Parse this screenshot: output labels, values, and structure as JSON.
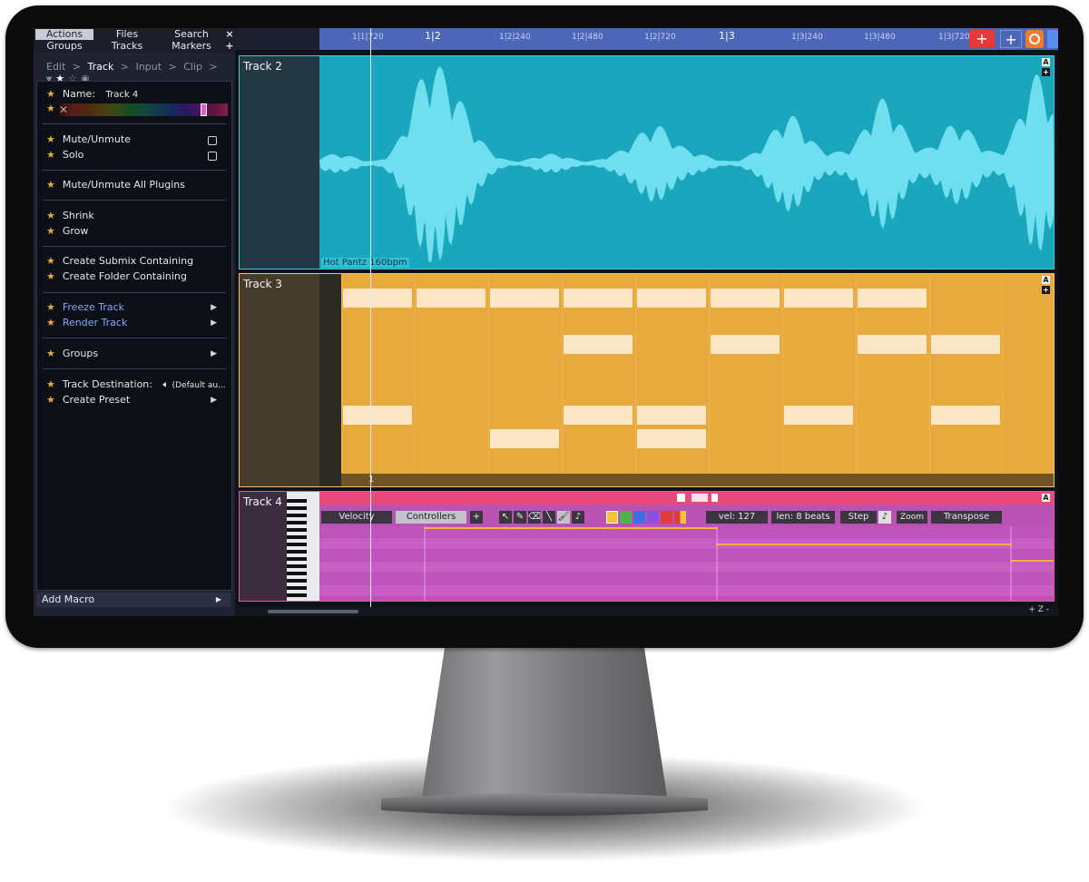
{
  "sidebar": {
    "tabs": [
      {
        "label": "Actions"
      },
      {
        "label": "Files"
      },
      {
        "label": "Search"
      },
      {
        "label": "Groups"
      },
      {
        "label": "Tracks"
      },
      {
        "label": "Markers"
      }
    ],
    "close_glyph": "×",
    "add_glyph": "+",
    "breadcrumb": [
      "Edit",
      ">",
      "Track",
      ">",
      "Input",
      ">",
      "Clip",
      ">"
    ],
    "name_label": "Name:",
    "name_value": "Track 4",
    "items": [
      {
        "label": "Mute/Unmute"
      },
      {
        "label": "Solo"
      },
      {
        "label": "Mute/Unmute All Plugins"
      },
      {
        "label": "Shrink"
      },
      {
        "label": "Grow"
      },
      {
        "label": "Create Submix Containing"
      },
      {
        "label": "Create Folder Containing"
      },
      {
        "label": "Freeze Track"
      },
      {
        "label": "Render Track"
      },
      {
        "label": "Groups"
      },
      {
        "label": "Track Destination:"
      },
      {
        "label": "Create Preset"
      }
    ],
    "destination_value": "(Default au...",
    "add_macro": "Add Macro"
  },
  "ruler": {
    "ticks": [
      "1|1|720",
      "1|2",
      "1|2|240",
      "1|2|480",
      "1|2|720",
      "1|3",
      "1|3|240",
      "1|3|480",
      "1|3|720"
    ]
  },
  "tracks": {
    "track2": {
      "name": "Track 2",
      "clip_label": "Hot Pantz 160bpm",
      "color": "#1aa6bc"
    },
    "track3": {
      "name": "Track 3",
      "color": "#e8a93d",
      "marker": "1"
    },
    "track4": {
      "name": "Track 4",
      "color": "#d256c8",
      "toolbar": {
        "velocity": "Velocity",
        "controllers": "Controllers",
        "plus": "+",
        "vel": "vel: 127",
        "len": "len: 8 beats",
        "step": "Step",
        "zoom": "Zoom",
        "transpose": "Transpose"
      }
    },
    "a_label": "A",
    "plus_label": "+"
  },
  "footer": {
    "zoom_label": "+ Z -"
  },
  "colors": {
    "accent_red": "#e63a3a",
    "accent_orange": "#ef7b2c",
    "ruler": "#4c66b8"
  }
}
